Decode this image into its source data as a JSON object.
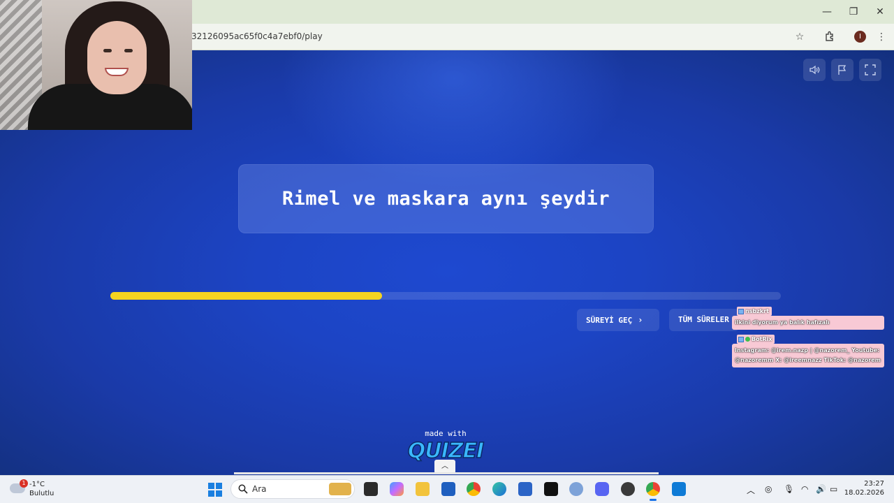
{
  "browser": {
    "url": "32126095ac65f0c4a7ebf0/play",
    "controls": {
      "minimize": "—",
      "restore": "❐",
      "close": "✕"
    },
    "profile_initial": "I"
  },
  "quiz": {
    "question": "Rimel ve maskara aynı şeydir",
    "progress_fraction": 0.405,
    "skip_timer_label": "SÜREYİ GEÇ",
    "all_timers_label": "TÜM SÜRELER",
    "footer_made_with": "made with",
    "footer_brand": "QUIZEI",
    "accent_color": "#f5d420"
  },
  "chat": [
    {
      "user": "nsbzkrt",
      "message": "ilkini diyorum ya balık hafızalı"
    },
    {
      "user": "BotRix",
      "message": "Instagram: @irem.nazp | @nazorem_ Youtube: @nazoremm X: @ireemnazz TikTok: @nazorem"
    }
  ],
  "taskbar": {
    "weather_temp": "-1°C",
    "weather_desc": "Bulutlu",
    "weather_badge": "1",
    "search_label": "Ara",
    "time": "23:27",
    "date": "18.02.2026"
  }
}
